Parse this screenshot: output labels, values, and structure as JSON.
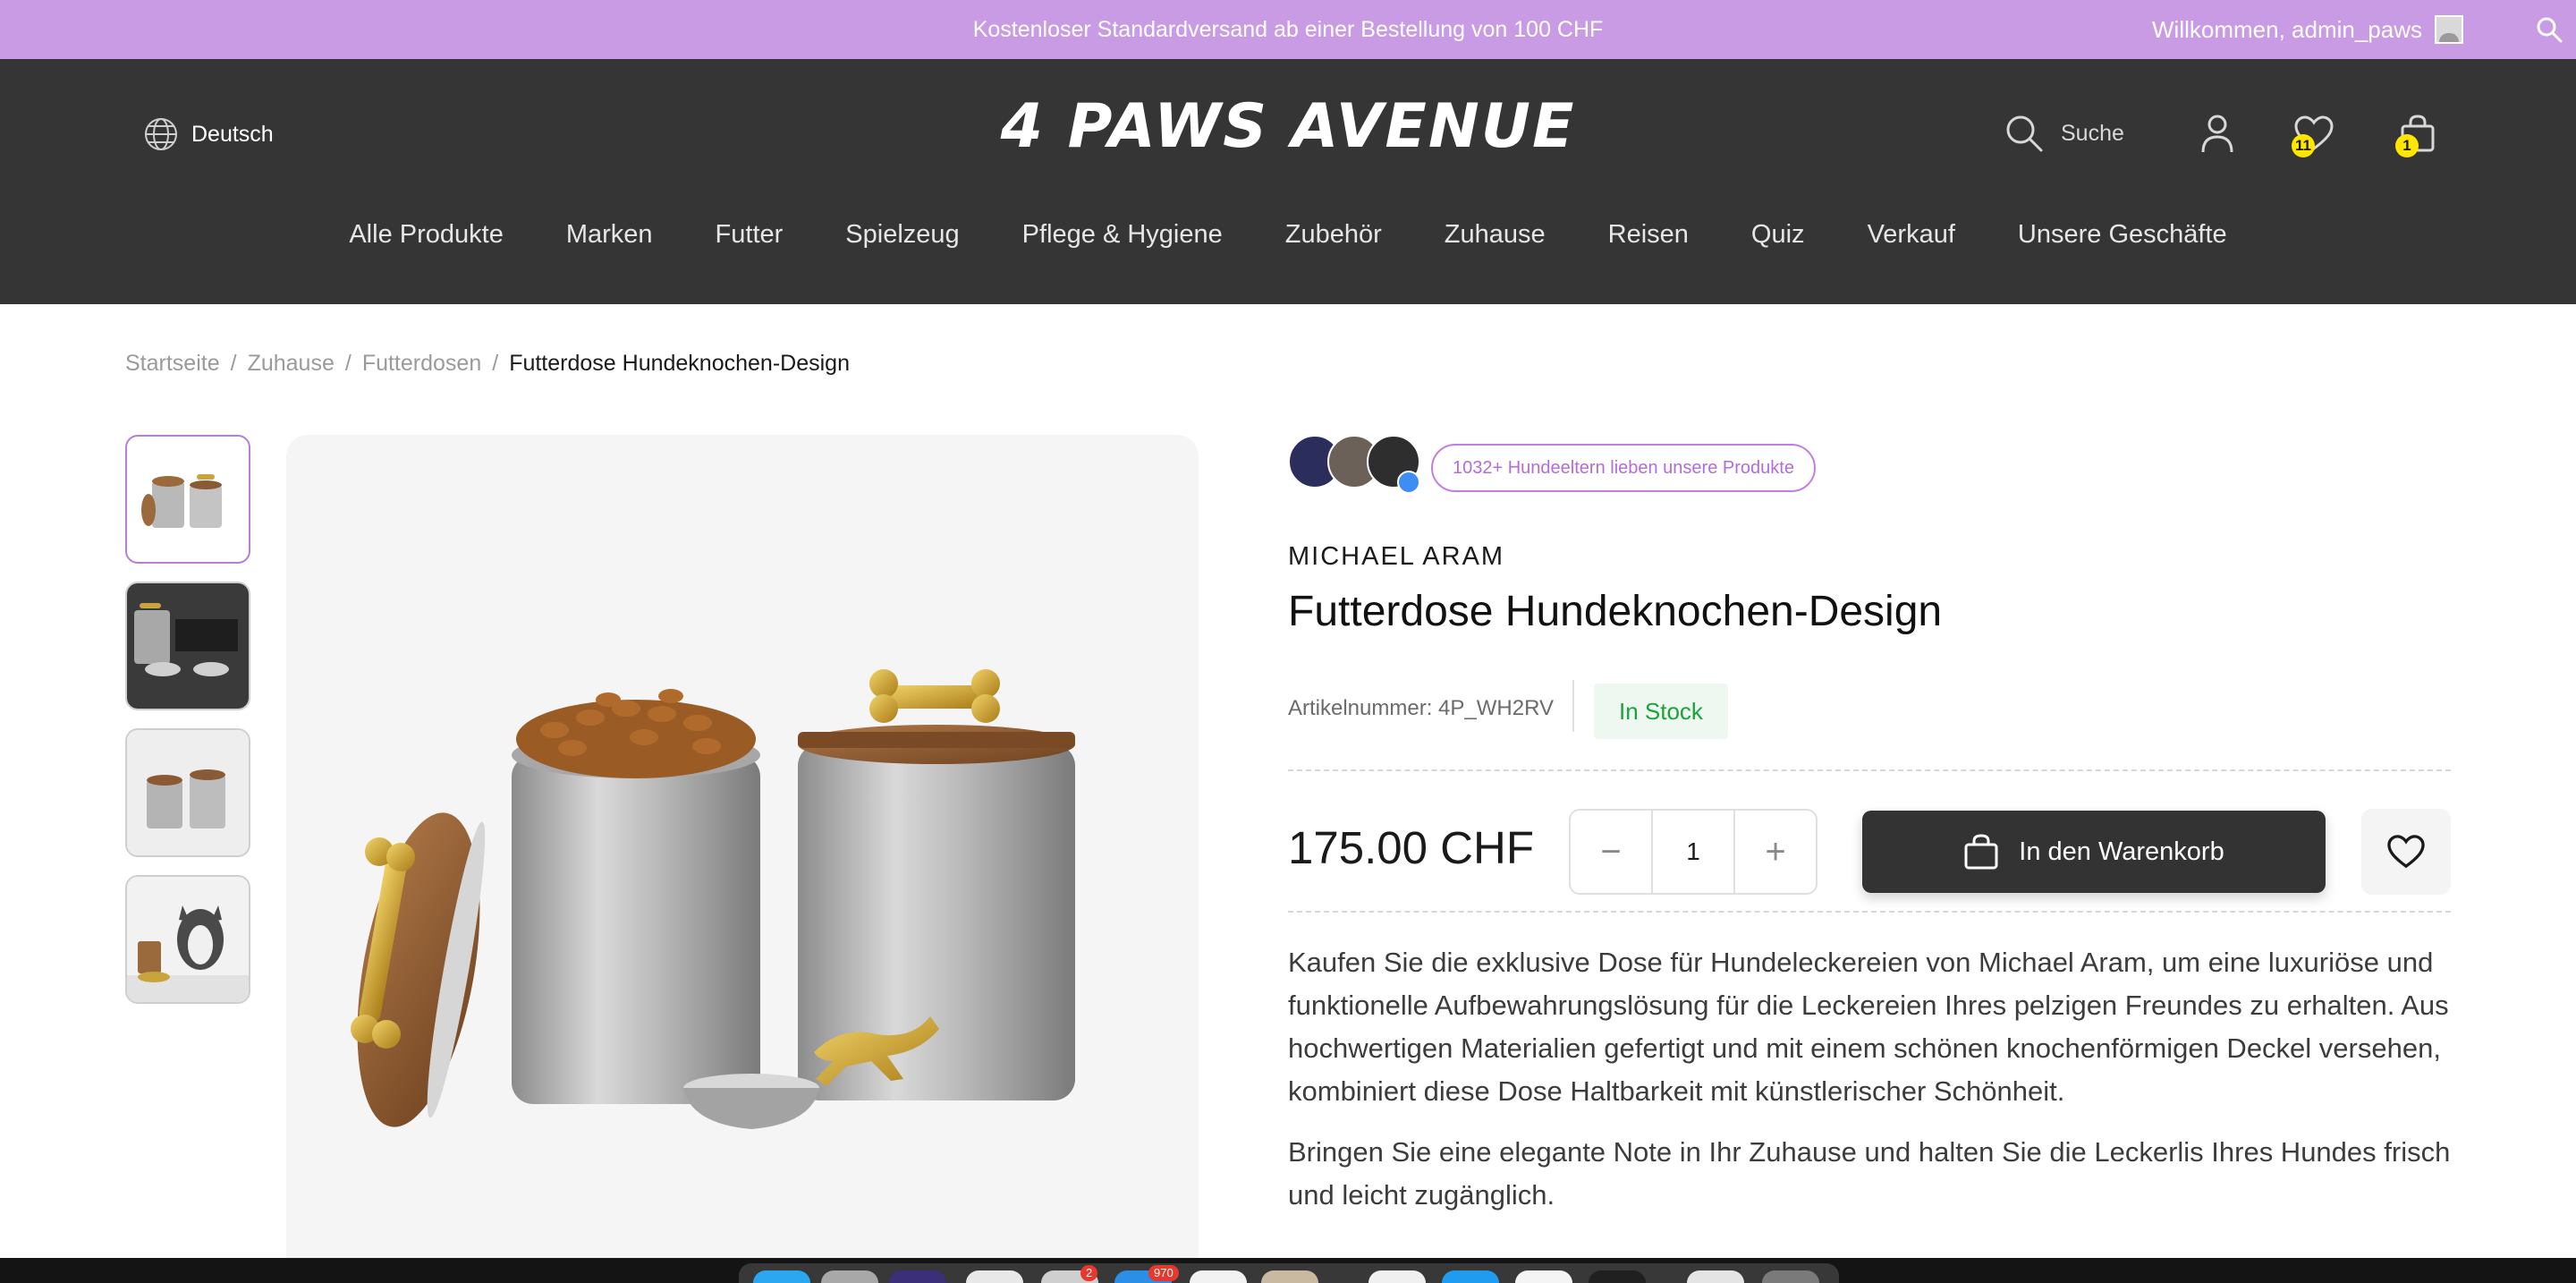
{
  "announcement": {
    "text": "Kostenloser Standardversand ab einer Bestellung von 100 CHF",
    "welcome": "Willkommen, admin_paws",
    "user_icon": "user-avatar-icon",
    "search_icon": "search-icon"
  },
  "header": {
    "language": "Deutsch",
    "logo": "4 PAWS AVENUE",
    "search_label": "Suche",
    "wishlist_count": "11",
    "cart_count": "1"
  },
  "nav": [
    "Alle Produkte",
    "Marken",
    "Futter",
    "Spielzeug",
    "Pflege & Hygiene",
    "Zubehör",
    "Zuhause",
    "Reisen",
    "Quiz",
    "Verkauf",
    "Unsere Geschäfte"
  ],
  "breadcrumb": {
    "items": [
      "Startseite",
      "Zuhause",
      "Futterdosen"
    ],
    "current": "Futterdose Hundeknochen-Design",
    "separator": "/"
  },
  "product": {
    "social_proof": "1032+ Hundeeltern lieben unsere Produkte",
    "brand": "MICHAEL ARAM",
    "title": "Futterdose Hundeknochen-Design",
    "sku": "Artikelnummer: 4P_WH2RV",
    "stock": "In Stock",
    "price": "175.00 CHF",
    "quantity": "1",
    "qty_minus": "−",
    "qty_plus": "+",
    "add_to_cart": "In den Warenkorb",
    "description": [
      "Kaufen Sie die exklusive Dose für Hundeleckereien von Michael Aram, um eine luxuriöse und funktionelle Aufbewahrungslösung für die Leckereien Ihres pelzigen Freundes zu erhalten. Aus hochwertigen Materialien gefertigt und mit einem schönen knochenförmigen Deckel versehen, kombiniert diese Dose Haltbarkeit mit künstlerischer Schönheit.",
      "Bringen Sie eine elegante Note in Ihr Zuhause und halten Sie die Leckerlis Ihres Hundes frisch und leicht zugänglich."
    ]
  },
  "dock": {
    "mail_badge": "2",
    "messages_badge": "970"
  },
  "colors": {
    "announcement_bg": "#c99be4",
    "header_bg": "#353535",
    "accent_purple": "#b46cd6",
    "badge_yellow": "#ffe600",
    "stock_green": "#1aa33a",
    "button_dark": "#333333"
  }
}
